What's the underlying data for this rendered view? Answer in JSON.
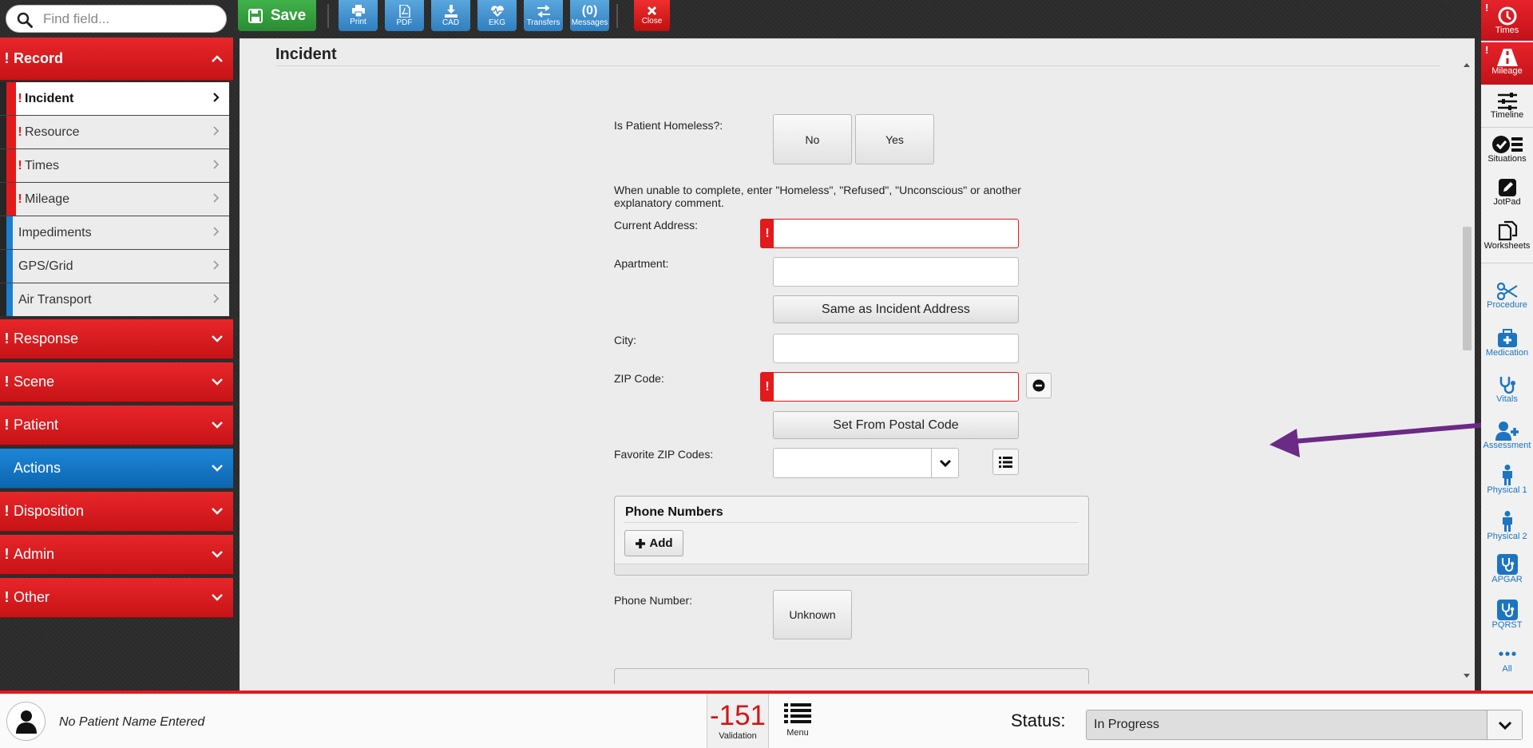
{
  "search": {
    "placeholder": "Find field..."
  },
  "toolbar": {
    "save": "Save",
    "buttons": [
      {
        "label": "Print",
        "icon": "printer-icon"
      },
      {
        "label": "PDF",
        "icon": "pdf-icon"
      },
      {
        "label": "CAD",
        "icon": "download-icon"
      },
      {
        "label": "EKG",
        "icon": "heart-monitor-icon"
      },
      {
        "label": "Transfers",
        "icon": "transfer-arrows-icon"
      },
      {
        "label": "Messages",
        "count": "(0)"
      }
    ],
    "close": "Close"
  },
  "sidebar": {
    "record": {
      "label": "Record",
      "required": true,
      "expanded": true
    },
    "record_items": [
      {
        "label": "Incident",
        "required": true,
        "active": true
      },
      {
        "label": "Resource",
        "required": true
      },
      {
        "label": "Times",
        "required": true
      },
      {
        "label": "Mileage",
        "required": true
      },
      {
        "label": "Impediments",
        "required": false
      },
      {
        "label": "GPS/Grid",
        "required": false
      },
      {
        "label": "Air Transport",
        "required": false
      }
    ],
    "sections": [
      {
        "label": "Response",
        "required": true,
        "color": "red"
      },
      {
        "label": "Scene",
        "required": true,
        "color": "red"
      },
      {
        "label": "Patient",
        "required": true,
        "color": "red"
      },
      {
        "label": "Actions",
        "required": false,
        "color": "blue"
      },
      {
        "label": "Disposition",
        "required": true,
        "color": "red"
      },
      {
        "label": "Admin",
        "required": true,
        "color": "red"
      },
      {
        "label": "Other",
        "required": true,
        "color": "red"
      }
    ]
  },
  "main": {
    "title": "Incident",
    "homeless": {
      "label": "Is Patient Homeless?:",
      "options": [
        "No",
        "Yes"
      ]
    },
    "hint": "When unable to complete, enter \"Homeless\", \"Refused\", \"Unconscious\" or another explanatory comment.",
    "current_address": {
      "label": "Current Address:",
      "value": ""
    },
    "apartment": {
      "label": "Apartment:",
      "value": ""
    },
    "same_as_incident": "Same as Incident Address",
    "city": {
      "label": "City:",
      "value": ""
    },
    "zip": {
      "label": "ZIP Code:",
      "value": ""
    },
    "set_from_postal": "Set From Postal Code",
    "favorite_zip": {
      "label": "Favorite ZIP Codes:",
      "value": ""
    },
    "phone_numbers": {
      "title": "Phone Numbers",
      "add": "Add"
    },
    "phone_number": {
      "label": "Phone Number:",
      "unknown": "Unknown"
    }
  },
  "rightrail": [
    {
      "label": "Times",
      "icon": "clock-icon",
      "required": true
    },
    {
      "label": "Mileage",
      "icon": "road-icon",
      "required": true
    },
    {
      "label": "Timeline",
      "icon": "sliders-icon"
    },
    {
      "label": "Situations",
      "icon": "checklist-icon"
    },
    {
      "label": "JotPad",
      "icon": "pencil-icon"
    },
    {
      "label": "Worksheets",
      "icon": "documents-icon"
    },
    {
      "label": "Procedure",
      "icon": "scissors-icon"
    },
    {
      "label": "Medication",
      "icon": "medkit-icon"
    },
    {
      "label": "Vitals",
      "icon": "stethoscope-icon"
    },
    {
      "label": "Assessment",
      "icon": "user-plus-icon"
    },
    {
      "label": "Physical 1",
      "icon": "person-icon"
    },
    {
      "label": "Physical 2",
      "icon": "person-icon"
    },
    {
      "label": "APGAR",
      "icon": "stethoscope-badge-icon"
    },
    {
      "label": "PQRST",
      "icon": "stethoscope-badge-icon"
    },
    {
      "label": "All",
      "icon": "ellipsis-icon"
    }
  ],
  "bottom": {
    "patient_name": "No Patient Name Entered",
    "validation_count": "-151",
    "validation_label": "Validation",
    "menu_label": "Menu",
    "status_label": "Status:",
    "status_value": "In Progress"
  },
  "colors": {
    "required_red": "#e31a1c",
    "action_blue": "#1b7fd0",
    "save_green": "#35a33e",
    "annotation_arrow": "#6a2a86"
  }
}
